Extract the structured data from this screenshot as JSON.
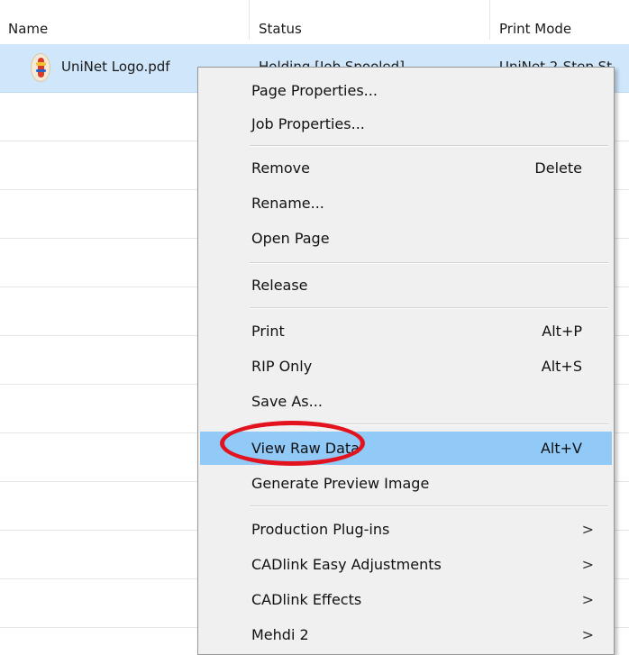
{
  "columns": {
    "name": "Name",
    "status": "Status",
    "print_mode": "Print Mode"
  },
  "job": {
    "filename": "UniNet Logo.pdf",
    "status": "Holding [Job Spooled]",
    "print_mode": "UniNet 2-Step St"
  },
  "context_menu": {
    "items": [
      {
        "label": "Page Properties..."
      },
      {
        "label": "Job Properties..."
      },
      {
        "label": "Remove",
        "shortcut": "Delete"
      },
      {
        "label": "Rename..."
      },
      {
        "label": "Open Page"
      },
      {
        "label": "Release"
      },
      {
        "label": "Print",
        "shortcut": "Alt+P"
      },
      {
        "label": "RIP Only",
        "shortcut": "Alt+S"
      },
      {
        "label": "Save As..."
      },
      {
        "label": "View Raw Data",
        "shortcut": "Alt+V",
        "highlighted": true
      },
      {
        "label": "Generate Preview Image"
      },
      {
        "label": "Production Plug-ins",
        "submenu": true
      },
      {
        "label": "CADlink Easy Adjustments",
        "submenu": true
      },
      {
        "label": "CADlink Effects",
        "submenu": true
      },
      {
        "label": "Mehdi 2",
        "submenu": true
      }
    ],
    "submenu_arrow": ">"
  },
  "colors": {
    "menu_highlight": "#91c9f7",
    "selected_row": "#cfe6fb",
    "annotation_ring": "#e2131e"
  },
  "icons": {
    "job_file": "pdf-file-icon",
    "submenu": "chevron-right-icon"
  }
}
